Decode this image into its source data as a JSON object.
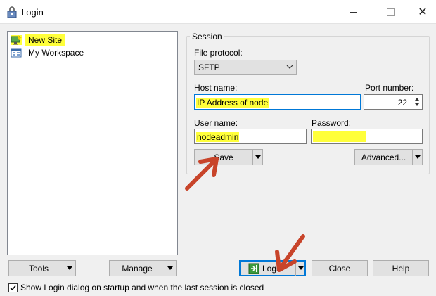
{
  "window": {
    "title": "Login",
    "close_glyph": "✕"
  },
  "tree": {
    "items": [
      {
        "label": "New Site",
        "icon": "new-site-icon",
        "highlighted": true
      },
      {
        "label": "My Workspace",
        "icon": "workspace-icon",
        "highlighted": false
      }
    ]
  },
  "session": {
    "group_title": "Session",
    "file_protocol_label": "File protocol:",
    "file_protocol_value": "SFTP",
    "host_label": "Host name:",
    "host_value": "IP Address of node",
    "port_label": "Port number:",
    "port_value": "22",
    "user_label": "User name:",
    "user_value": "nodeadmin",
    "password_label": "Password:",
    "password_value": ""
  },
  "buttons": {
    "save": "Save",
    "advanced": "Advanced...",
    "tools": "Tools",
    "manage": "Manage",
    "login": "Login",
    "close": "Close",
    "help": "Help"
  },
  "footer": {
    "show_login_label": "Show Login dialog on startup and when the last session is closed",
    "show_login_checked": true
  },
  "colors": {
    "highlight": "#ffff3a",
    "focus_border": "#0078d7",
    "annotation_arrow": "#c8442a"
  },
  "annotations": [
    {
      "name": "arrow-pointing-save",
      "icon": "red-arrow"
    },
    {
      "name": "arrow-pointing-login",
      "icon": "red-arrow"
    }
  ]
}
